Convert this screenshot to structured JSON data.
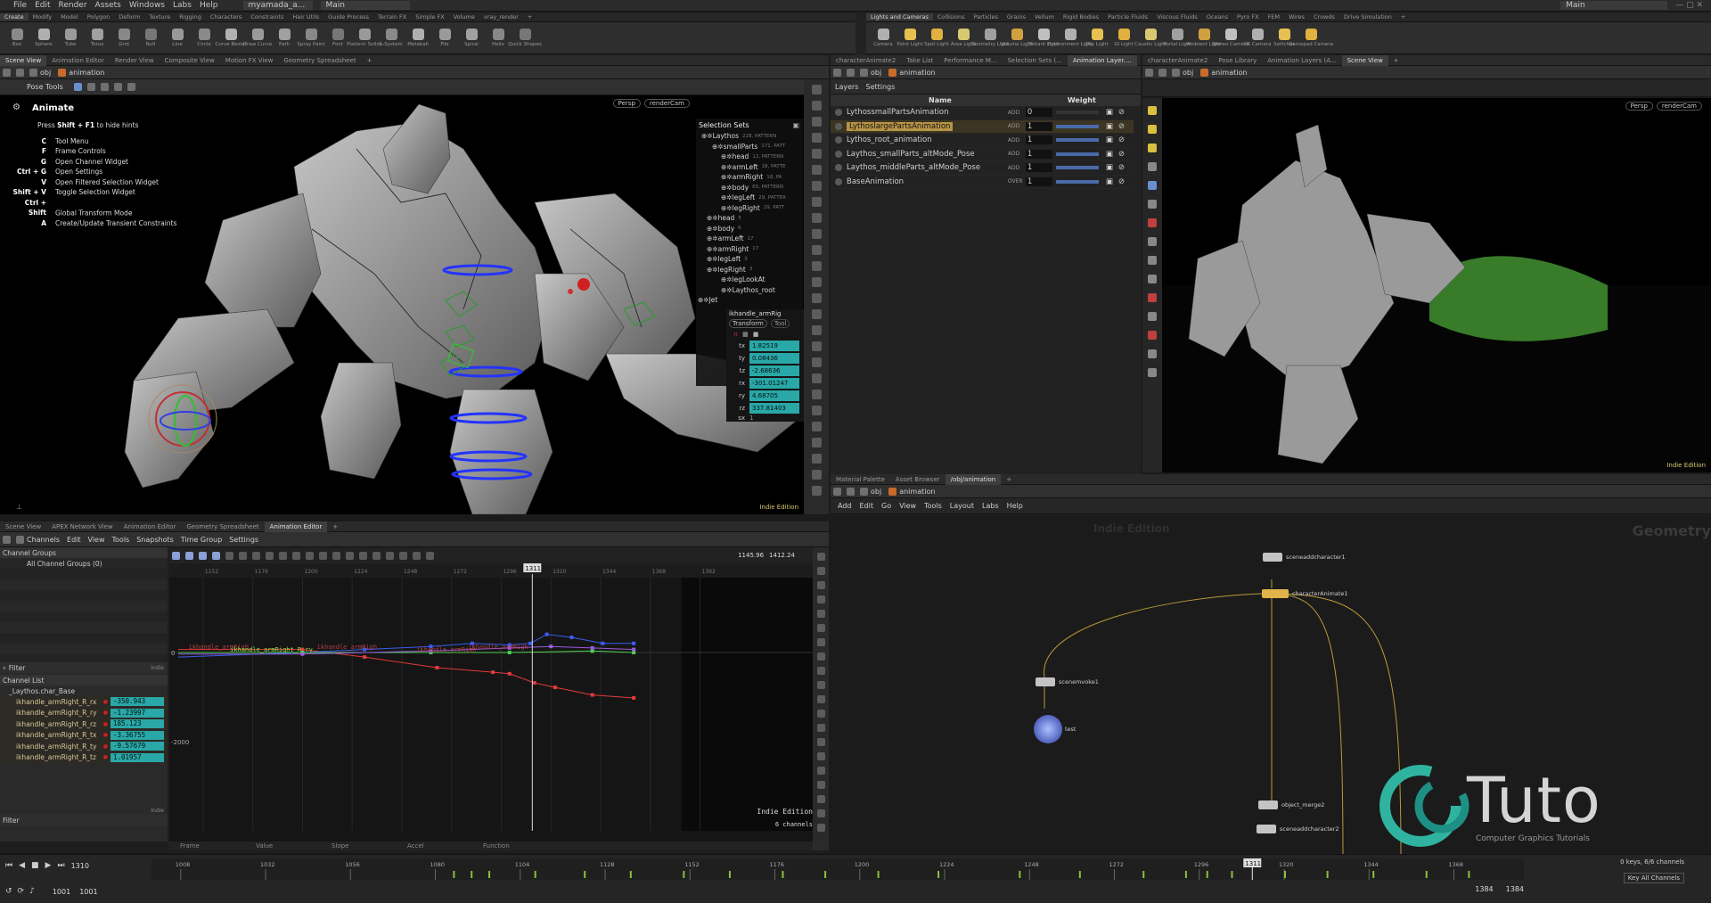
{
  "menubar": {
    "items": [
      "File",
      "Edit",
      "Render",
      "Assets",
      "Windows",
      "Labs",
      "Help"
    ],
    "scene": "myamada_a...",
    "desktop": "Main",
    "desktop_right": "Main"
  },
  "shelf_left": {
    "tabs": [
      "Create",
      "Modify",
      "Model",
      "Polygon",
      "Deform",
      "Texture",
      "Rigging",
      "Characters",
      "Constraints",
      "Hair Utils",
      "Guide Process",
      "Terrain FX",
      "Simple FX",
      "Volume",
      "vray_render"
    ],
    "tools": [
      "Box",
      "Sphere",
      "Tube",
      "Torus",
      "Grid",
      "Null",
      "Line",
      "Circle",
      "Curve Bezier",
      "Draw Curve",
      "Path",
      "Spray Paint",
      "Font",
      "Platonic Solids",
      "L-System",
      "Metaball",
      "File",
      "Spiral",
      "Helix",
      "Quick Shapes"
    ]
  },
  "shelf_right": {
    "tabs": [
      "Lights and Cameras",
      "Collisions",
      "Particles",
      "Grains",
      "Vellum",
      "Rigid Bodies",
      "Particle Fluids",
      "Viscous Fluids",
      "Oceans",
      "Pyro FX",
      "FEM",
      "Wires",
      "Crowds",
      "Drive Simulation"
    ],
    "tools": [
      "Camera",
      "Point Light",
      "Spot Light",
      "Area Light",
      "Geometry Light",
      "Volume Light",
      "Distant Light",
      "Environment Light",
      "Sky Light",
      "GI Light",
      "Caustic Light",
      "Portal Light",
      "Ambient Light",
      "Stereo Camera",
      "VR Camera",
      "Switcher",
      "Gamepad Camera"
    ]
  },
  "top_left_tabs": [
    "Scene View",
    "Animation Editor",
    "Render View",
    "Composite View",
    "Motion FX View",
    "Geometry Spreadsheet"
  ],
  "top_mid_tabs": [
    "characterAnimate2",
    "Take List",
    "Performance M...",
    "Selection Sets (...",
    "Animation Layer...."
  ],
  "top_right_tabs": [
    "characterAnimate2",
    "Pose Library",
    "Animation Layers (A...",
    "Scene View"
  ],
  "path": {
    "obj": "obj",
    "node": "animation"
  },
  "pose_tools": {
    "title": "Pose Tools"
  },
  "viewport": {
    "persp": "Persp",
    "cam": "renderCam",
    "edition": "Indie Edition",
    "hud": {
      "title": "Animate",
      "subtitle_pre": "Press ",
      "subtitle_key": "Shift + F1",
      "subtitle_post": " to hide hints",
      "hints": [
        {
          "key": "C",
          "label": "Tool Menu"
        },
        {
          "key": "F",
          "label": "Frame Controls"
        },
        {
          "key": "G",
          "label": "Open Channel Widget"
        },
        {
          "key": "Ctrl + G",
          "label": "Open Settings"
        },
        {
          "key": "V",
          "label": "Open Filtered Selection Widget"
        },
        {
          "key": "Shift + V",
          "label": "Toggle Selection Widget"
        },
        {
          "key": "Ctrl + Shift",
          "label": "Global Transform Mode"
        },
        {
          "key": "A",
          "label": "Create/Update Transient Constraints"
        }
      ]
    }
  },
  "selection_sets": {
    "title": "Selection Sets",
    "items": [
      {
        "name": "Laythos",
        "count": "228, PATTERN"
      },
      {
        "name": "smallParts",
        "count": "171, PATT"
      },
      {
        "name": "head",
        "count": "12, PATTERN"
      },
      {
        "name": "armLeft",
        "count": "18, PATTE"
      },
      {
        "name": "armRight",
        "count": "18, PA"
      },
      {
        "name": "body",
        "count": "65, PATTERN"
      },
      {
        "name": "legLeft",
        "count": "29, PATTER"
      },
      {
        "name": "legRight",
        "count": "29, PATT"
      },
      {
        "name": "head",
        "count": "5"
      },
      {
        "name": "body",
        "count": "6"
      },
      {
        "name": "armLeft",
        "count": "17"
      },
      {
        "name": "armRight",
        "count": "17"
      },
      {
        "name": "legLeft",
        "count": "3"
      },
      {
        "name": "legRight",
        "count": "3"
      },
      {
        "name": "legLookAt",
        "count": ""
      },
      {
        "name": "Laythos_root",
        "count": ""
      },
      {
        "name": "Jet",
        "count": ""
      }
    ]
  },
  "transform": {
    "title": "ikhandle_armRig",
    "tab1": "Transform",
    "tab2": "Tool",
    "fields": [
      {
        "label": "tx",
        "value": "1.82519"
      },
      {
        "label": "ty",
        "value": "0.08436"
      },
      {
        "label": "tz",
        "value": "-2.68636"
      },
      {
        "label": "rx",
        "value": "-301.01247"
      },
      {
        "label": "ry",
        "value": "4.68705"
      },
      {
        "label": "rz",
        "value": "337.81403"
      },
      {
        "label": "sx",
        "value": "1"
      }
    ]
  },
  "layers": {
    "menu": [
      "Layers",
      "Settings"
    ],
    "col_name": "Name",
    "col_weight": "Weight",
    "rows": [
      {
        "name": "LythossmallPartsAnimation",
        "mode": "ADD",
        "weight": "0",
        "selected": false
      },
      {
        "name": "LythoslargePartsAnimation",
        "mode": "ADD",
        "weight": "1",
        "selected": true
      },
      {
        "name": "Lythos_root_animation",
        "mode": "ADD",
        "weight": "1",
        "selected": false
      },
      {
        "name": "Laythos_smallParts_altMode_Pose",
        "mode": "ADD",
        "weight": "1",
        "selected": false
      },
      {
        "name": "Laythos_middleParts_altMode_Pose",
        "mode": "ADD",
        "weight": "1",
        "selected": false
      },
      {
        "name": "BaseAnimation",
        "mode": "OVER",
        "weight": "1",
        "selected": false
      }
    ]
  },
  "right_viewport": {
    "persp": "Persp",
    "cam": "renderCam",
    "edition": "Indie Edition"
  },
  "bottom_left_tabs": [
    "Scene View",
    "APEX Network View",
    "Animation Editor",
    "Geometry Spreadsheet",
    "Animation Editor"
  ],
  "anim_menu": [
    "Channels",
    "Edit",
    "View",
    "Tools",
    "Snapshots",
    "Time Group",
    "Settings"
  ],
  "channel_groups": {
    "title": "Channel Groups",
    "all": "All Channel Groups (0)",
    "filter": "Filter",
    "indie": "Indie"
  },
  "channel_list": {
    "title": "Channel List",
    "root": "_Laythos.char_Base",
    "rows": [
      {
        "name": "ikhandle_armRight_R_rx",
        "value": "-350.943"
      },
      {
        "name": "ikhandle_armRight_R_ry",
        "value": "-1.23997"
      },
      {
        "name": "ikhandle_armRight_R_rz",
        "value": "185.123"
      },
      {
        "name": "ikhandle_armRight_R_tx",
        "value": "-3.36755"
      },
      {
        "name": "ikhandle_armRight_R_ty",
        "value": "-9.57679"
      },
      {
        "name": "ikhandle_armRight_R_tz",
        "value": "1.01957"
      }
    ],
    "filter": "Filter",
    "indie": "Indie"
  },
  "graph": {
    "range_start": "1145.96",
    "range_end": "1412.24",
    "current_frame": "1311",
    "ruler": [
      "1152",
      "1176",
      "1200",
      "1224",
      "1248",
      "1272",
      "1296",
      "1320",
      "1344",
      "1368",
      "1392"
    ],
    "y_labels": [
      "0",
      "-2000"
    ],
    "curve_labels": [
      "ikhandle_armRigh",
      "ikhandle_armRight_R_ry",
      "ikhandle_armRigh",
      "ikhandle_armRigh",
      "ikhandle_armRigh"
    ],
    "edition": "Indie Edition",
    "channels": "6 channels",
    "footer": [
      "Frame",
      "Value",
      "Slope",
      "Accel",
      "Function"
    ],
    "colors": {
      "red": "#e23a3a",
      "blue": "#3c5cf0",
      "green": "#4fd04f",
      "purple": "#9a5ce0"
    }
  },
  "network": {
    "tabs": [
      "Material Palette",
      "Asset Browser",
      "/obj/animation"
    ],
    "menu": [
      "Add",
      "Edit",
      "Go",
      "View",
      "Tools",
      "Layout",
      "Labs",
      "Help"
    ],
    "edition": "Indie Edition",
    "context": "Geometry",
    "nodes": [
      "sceneaddcharacter1",
      "characterAnimate1",
      "scenemvoke1",
      "test",
      "object_merge2",
      "sceneaddcharacter2"
    ]
  },
  "playbar": {
    "frame": "1310",
    "start": "1001",
    "start2": "1001",
    "ticks": [
      "1008",
      "1032",
      "1056",
      "1080",
      "1104",
      "1128",
      "1152",
      "1176",
      "1200",
      "1224",
      "1248",
      "1272",
      "1296",
      "1320",
      "1344",
      "1368"
    ],
    "current": "1311",
    "end": "1384",
    "end2": "1384",
    "keys": "0 keys, 6/6 channels",
    "key_all": "Key All Channels"
  },
  "watermark": {
    "brand": "Tuto",
    "tagline": "Computer Graphics Tutorials"
  }
}
